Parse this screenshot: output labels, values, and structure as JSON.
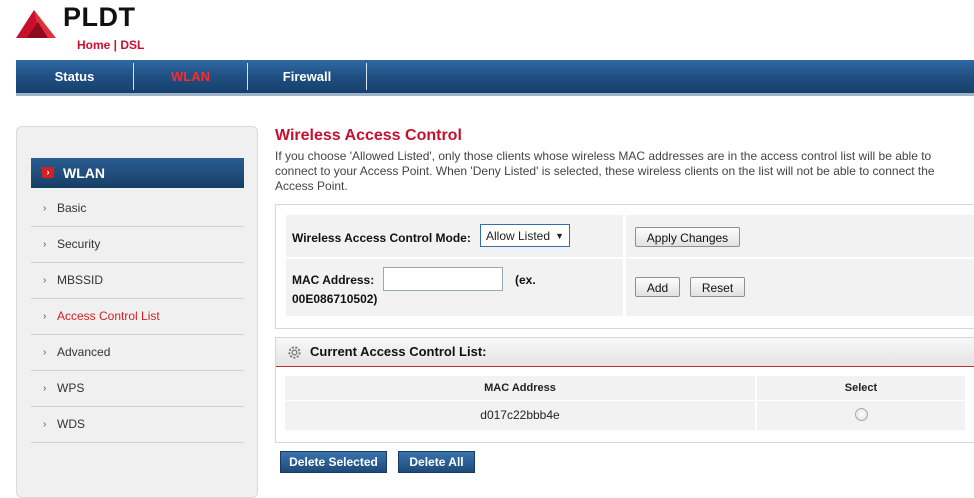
{
  "brand": {
    "name": "PLDT",
    "subtitle": "Home | DSL"
  },
  "nav": {
    "tabs": [
      "Status",
      "WLAN",
      "Firewall"
    ],
    "active": "WLAN"
  },
  "sidebar": {
    "header": "WLAN",
    "items": [
      "Basic",
      "Security",
      "MBSSID",
      "Access Control List",
      "Advanced",
      "WPS",
      "WDS"
    ],
    "active": "Access Control List"
  },
  "page": {
    "title": "Wireless Access Control",
    "description": "If you choose 'Allowed Listed', only those clients whose wireless MAC addresses are in the access control list will be able to connect to your Access Point. When 'Deny Listed' is selected, these wireless clients on the list will not be able to connect the Access Point."
  },
  "form": {
    "mode_label": "Wireless Access Control Mode:",
    "mode_value": "Allow Listed",
    "apply_label": "Apply Changes",
    "mac_label": "MAC Address:",
    "mac_value": "",
    "mac_example": "(ex.",
    "mac_example_value": "00E086710502)",
    "add_label": "Add",
    "reset_label": "Reset"
  },
  "acl": {
    "title": "Current Access Control List:",
    "columns": [
      "MAC Address",
      "Select"
    ],
    "rows": [
      {
        "mac": "d017c22bbb4e",
        "selected": false
      }
    ]
  },
  "actions": {
    "delete_selected": "Delete Selected",
    "delete_all": "Delete All"
  },
  "colors": {
    "accent_red": "#c8102e",
    "nav_blue": "#1f4f82"
  }
}
